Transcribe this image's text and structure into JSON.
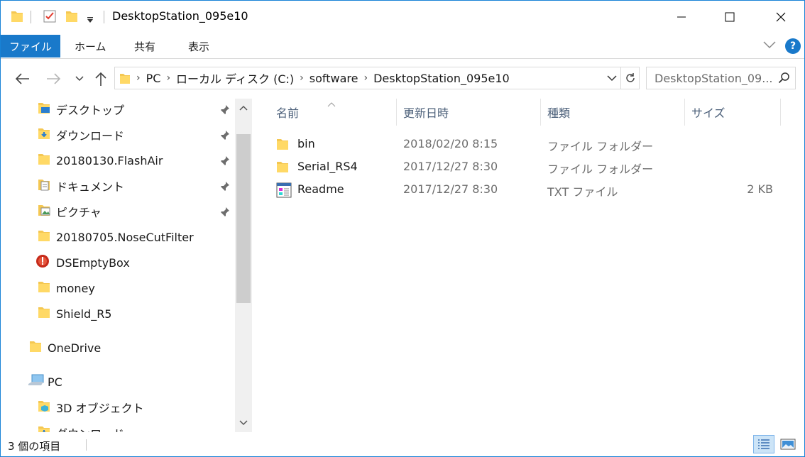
{
  "window": {
    "title": "DesktopStation_095e10",
    "accent": "#1979ca"
  },
  "ribbon": {
    "tabs": [
      "ファイル",
      "ホーム",
      "共有",
      "表示"
    ],
    "help": "?"
  },
  "address": {
    "crumbs": [
      "PC",
      "ローカル ディスク (C:)",
      "software",
      "DesktopStation_095e10"
    ]
  },
  "search": {
    "text": "DesktopStation_09..."
  },
  "navpane": {
    "quick_access": [
      {
        "label": "デスクトップ",
        "icon": "desktop-folder-icon",
        "pinned": true
      },
      {
        "label": "ダウンロード",
        "icon": "downloads-folder-icon",
        "pinned": true
      },
      {
        "label": "20180130.FlashAir",
        "icon": "folder-icon",
        "pinned": true
      },
      {
        "label": "ドキュメント",
        "icon": "documents-folder-icon",
        "pinned": true
      },
      {
        "label": "ピクチャ",
        "icon": "pictures-folder-icon",
        "pinned": true
      },
      {
        "label": "20180705.NoseCutFilter",
        "icon": "folder-icon",
        "pinned": false
      },
      {
        "label": "DSEmptyBox",
        "icon": "red-app-icon",
        "pinned": false
      },
      {
        "label": "money",
        "icon": "folder-icon",
        "pinned": false
      },
      {
        "label": "Shield_R5",
        "icon": "folder-icon",
        "pinned": false
      }
    ],
    "onedrive": "OneDrive",
    "pc": "PC",
    "pc_items": [
      {
        "label": "3D オブジェクト",
        "icon": "3d-objects-folder-icon"
      },
      {
        "label": "ダウンロード",
        "icon": "downloads-folder-icon"
      }
    ]
  },
  "filelist": {
    "columns": [
      "名前",
      "更新日時",
      "種類",
      "サイズ"
    ],
    "rows": [
      {
        "name": "bin",
        "date": "2018/02/20 8:15",
        "type": "ファイル フォルダー",
        "size": "",
        "icon": "folder-icon"
      },
      {
        "name": "Serial_RS4",
        "date": "2017/12/27 8:30",
        "type": "ファイル フォルダー",
        "size": "",
        "icon": "folder-icon"
      },
      {
        "name": "Readme",
        "date": "2017/12/27 8:30",
        "type": "TXT ファイル",
        "size": "2 KB",
        "icon": "text-file-icon"
      }
    ]
  },
  "status": {
    "count": "3 個の項目"
  }
}
